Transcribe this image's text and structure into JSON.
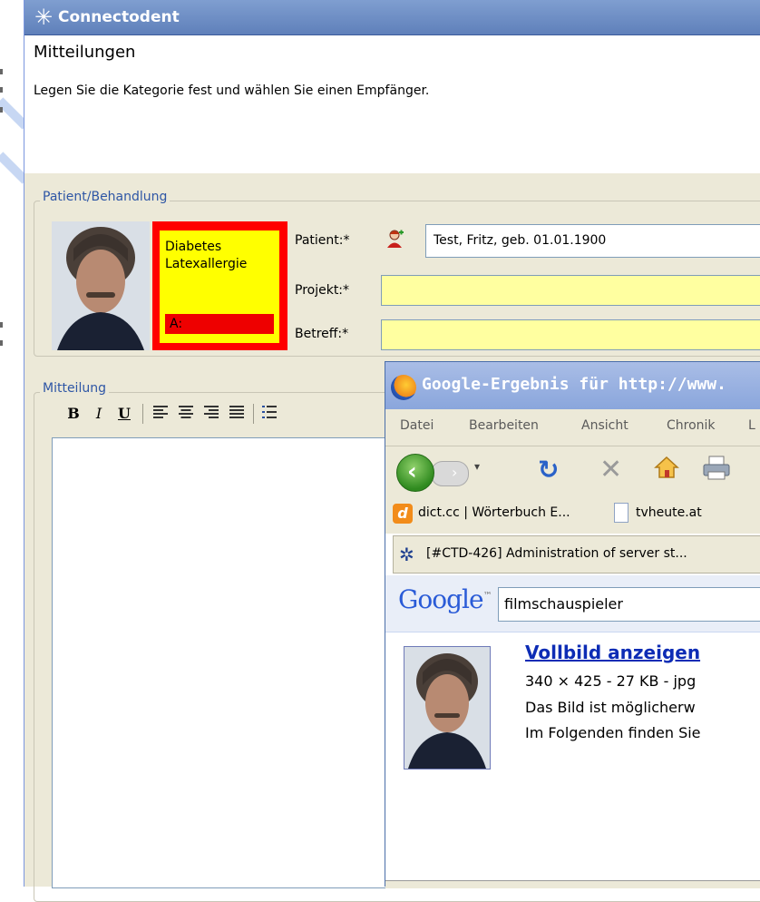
{
  "window": {
    "title": "Connectodent"
  },
  "header": {
    "title": "Mitteilungen",
    "subtitle": "Legen Sie die Kategorie fest und wählen Sie einen Empfänger."
  },
  "patient_group": {
    "label": "Patient/Behandlung",
    "alert_lines": [
      "Diabetes",
      "Latexallergie"
    ],
    "alert_bar": "A:",
    "fields": {
      "patient_label": "Patient:*",
      "patient_value": "Test, Fritz, geb. 01.01.1900",
      "project_label": "Projekt:*",
      "project_value": "",
      "subject_label": "Betreff:*",
      "subject_value": ""
    }
  },
  "message_group": {
    "label": "Mitteilung",
    "toolbar": {
      "bold": "B",
      "italic": "I",
      "underline": "U"
    }
  },
  "browser": {
    "title": "Google-Ergebnis für http://www.",
    "menu": [
      "Datei",
      "Bearbeiten",
      "Ansicht",
      "Chronik",
      "L"
    ],
    "bookmarks": [
      "dict.cc | Wörterbuch E...",
      "tvheute.at"
    ],
    "tab": "[#CTD-426] Administration of server st...",
    "google": {
      "logo": "Google",
      "tm": "™",
      "query": "filmschauspieler",
      "result_title": "Vollbild anzeigen",
      "result_meta": "340 × 425 - 27 KB - jpg",
      "result_text_1": "Das Bild ist möglicherw",
      "result_text_2": "Im Folgenden finden Sie"
    }
  },
  "colors": {
    "alert_border": "#ff0000",
    "alert_fill": "#ffff00",
    "required_field": "#ffffa0",
    "group_label": "#2e56a5",
    "link": "#0d2cb5"
  }
}
